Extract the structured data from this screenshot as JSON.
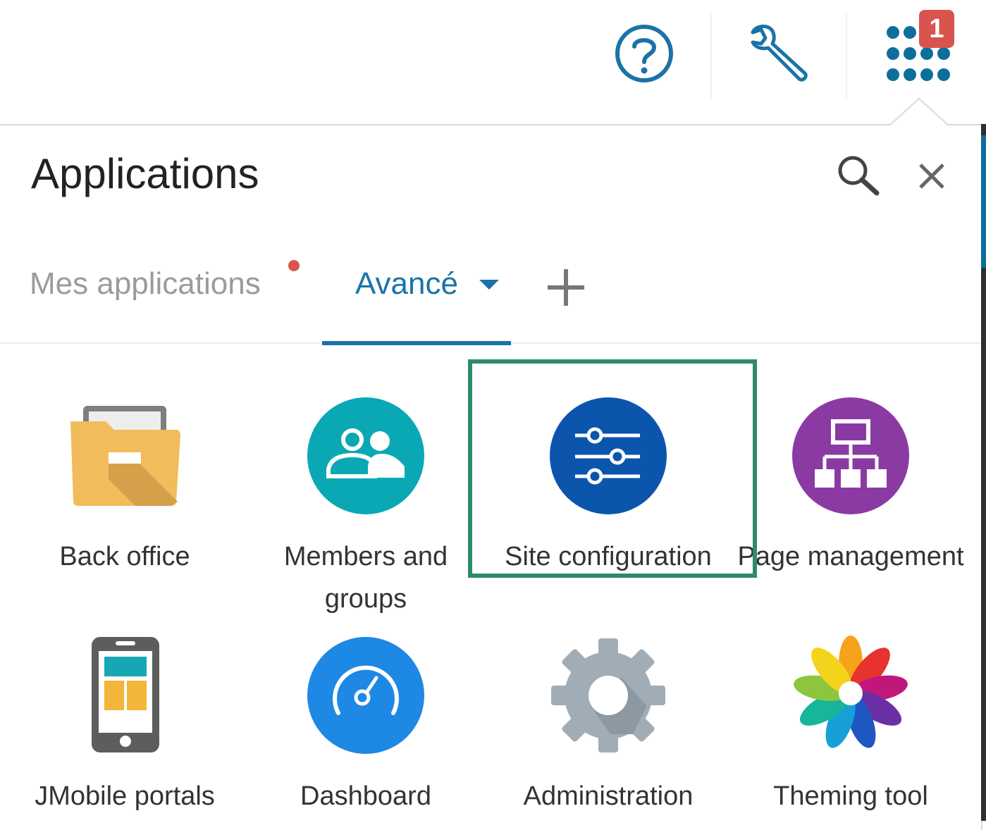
{
  "topbar": {
    "help_icon": "help-circle-icon",
    "tools_icon": "wrench-icon",
    "apps_icon": "apps-grid-icon",
    "notification_count": "1"
  },
  "panel": {
    "title": "Applications",
    "search_icon": "search-icon",
    "close_icon": "close-icon"
  },
  "tabs": {
    "mes_applications": "Mes applications",
    "avance": "Avancé",
    "add_icon": "plus-icon"
  },
  "apps": [
    {
      "label": "Back office",
      "icon": "folder-icon"
    },
    {
      "label": "Members and groups",
      "icon": "members-groups-icon"
    },
    {
      "label": "Site configuration",
      "icon": "sliders-icon"
    },
    {
      "label": "Page management",
      "icon": "sitemap-icon"
    },
    {
      "label": "JMobile portals",
      "icon": "mobile-phone-icon"
    },
    {
      "label": "Dashboard",
      "icon": "speedometer-icon"
    },
    {
      "label": "Administration",
      "icon": "gear-icon"
    },
    {
      "label": "Theming tool",
      "icon": "color-flower-icon"
    }
  ],
  "colors": {
    "accent": "#1a73a8",
    "badge": "#d9534f",
    "highlight": "#2e8b67",
    "members": "#0aa8b5",
    "site_config": "#0b55ad",
    "page_mgmt": "#8b3aa4",
    "dashboard": "#1e88e5"
  }
}
